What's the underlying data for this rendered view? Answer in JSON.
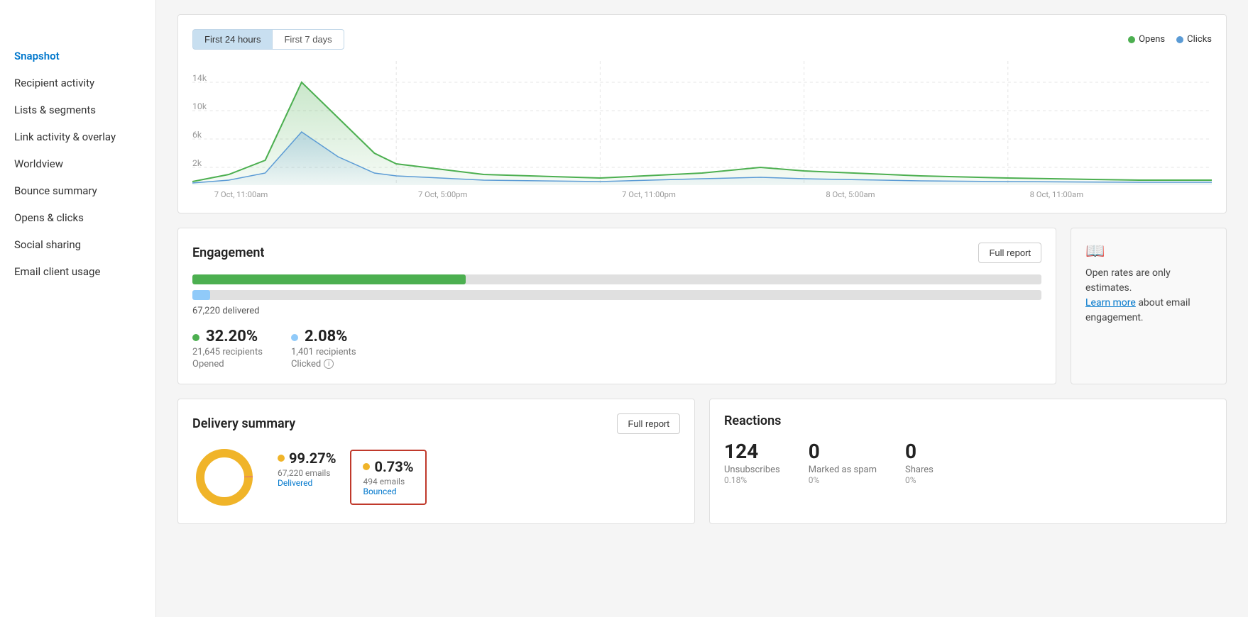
{
  "sidebar": {
    "items": [
      {
        "label": "Snapshot",
        "active": true,
        "id": "snapshot"
      },
      {
        "label": "Recipient activity",
        "active": false,
        "id": "recipient-activity"
      },
      {
        "label": "Lists & segments",
        "active": false,
        "id": "lists-segments"
      },
      {
        "label": "Link activity & overlay",
        "active": false,
        "id": "link-activity"
      },
      {
        "label": "Worldview",
        "active": false,
        "id": "worldview"
      },
      {
        "label": "Bounce summary",
        "active": false,
        "id": "bounce-summary"
      },
      {
        "label": "Opens & clicks",
        "active": false,
        "id": "opens-clicks"
      },
      {
        "label": "Social sharing",
        "active": false,
        "id": "social-sharing"
      },
      {
        "label": "Email client usage",
        "active": false,
        "id": "email-client"
      }
    ]
  },
  "chart": {
    "tab1": "First 24 hours",
    "tab2": "First 7 days",
    "legend_opens": "Opens",
    "legend_clicks": "Clicks",
    "x_labels": [
      "7 Oct, 11:00am",
      "7 Oct, 5:00pm",
      "7 Oct, 11:00pm",
      "8 Oct, 5:00am",
      "8 Oct, 11:00am"
    ],
    "y_labels": [
      "14k",
      "10k",
      "6k",
      "2k"
    ]
  },
  "engagement": {
    "title": "Engagement",
    "full_report_btn": "Full report",
    "delivered_label": "67,220 delivered",
    "open_rate": "32.20%",
    "open_recipients": "21,645 recipients",
    "open_label": "Opened",
    "click_rate": "2.08%",
    "click_recipients": "1,401 recipients",
    "click_label": "Clicked",
    "open_bar_pct": 32.2,
    "click_bar_pct": 2.08
  },
  "notice": {
    "text": "Open rates are only estimates.",
    "link": "Learn more",
    "suffix": "about email engagement."
  },
  "delivery": {
    "title": "Delivery summary",
    "full_report_btn": "Full report",
    "delivered_pct": "99.27%",
    "delivered_emails": "67,220 emails",
    "delivered_label": "Delivered",
    "bounced_pct": "0.73%",
    "bounced_emails": "494 emails",
    "bounced_label": "Bounced",
    "delivered_dot_color": "#f0b429",
    "bounced_dot_color": "#f0b429"
  },
  "reactions": {
    "title": "Reactions",
    "unsubscribes_value": "124",
    "unsubscribes_label": "Unsubscribes",
    "unsubscribes_pct": "0.18%",
    "spam_value": "0",
    "spam_label": "Marked as spam",
    "spam_pct": "0%",
    "shares_value": "0",
    "shares_label": "Shares",
    "shares_pct": "0%"
  }
}
